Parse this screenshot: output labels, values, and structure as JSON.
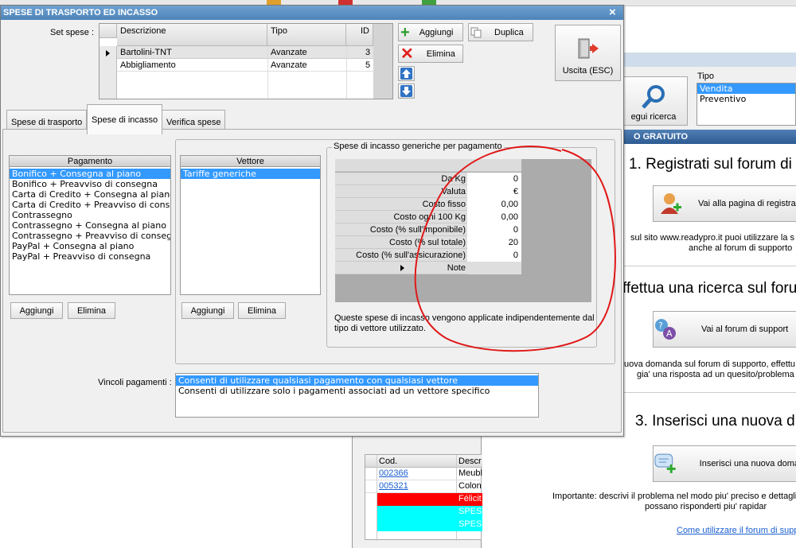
{
  "dialog": {
    "title": "SPESE DI TRASPORTO ED INCASSO",
    "close_glyph": "×"
  },
  "set_spese": {
    "label": "Set spese :",
    "columns": [
      "Descrizione",
      "Tipo",
      "ID"
    ],
    "rows": [
      {
        "desc": "Bartolini-TNT",
        "tipo": "Avanzate",
        "id": "3"
      },
      {
        "desc": "Abbigliamento",
        "tipo": "Avanzate",
        "id": "5"
      }
    ]
  },
  "toolbar": {
    "aggiungi": "Aggiungi",
    "duplica": "Duplica",
    "elimina": "Elimina",
    "uscita": "Uscita (ESC)"
  },
  "tabs": [
    "Spese di trasporto",
    "Spese di incasso",
    "Verifica spese"
  ],
  "pagamento": {
    "header": "Pagamento",
    "items": [
      "Bonifico + Consegna al piano",
      "Bonifico + Preavviso di consegna",
      "Carta di Credito + Consegna al piano",
      "Carta di Credito + Preavviso di consegna",
      "Contrassegno",
      "Contrassegno + Consegna al piano",
      "Contrassegno + Preavviso di consegna",
      "PayPal + Consegna al piano",
      "PayPal + Preavviso di consegna"
    ],
    "aggiungi": "Aggiungi",
    "elimina": "Elimina"
  },
  "vettore": {
    "header": "Vettore",
    "items": [
      "Tariffe generiche"
    ],
    "aggiungi": "Aggiungi",
    "elimina": "Elimina"
  },
  "generiche": {
    "title": "Spese di incasso generiche per pagamento",
    "rows": [
      {
        "label": "Da Kg",
        "value": "0"
      },
      {
        "label": "Valuta",
        "value": "€"
      },
      {
        "label": "Costo fisso",
        "value": "0,00"
      },
      {
        "label": "Costo ogni 100 Kg",
        "value": "0,00"
      },
      {
        "label": "Costo (% sull'imponibile)",
        "value": "0"
      },
      {
        "label": "Costo (% sul totale)",
        "value": "20"
      },
      {
        "label": "Costo (% sull'assicurazione)",
        "value": "0"
      },
      {
        "label": "Note",
        "value": ""
      }
    ],
    "description": "Queste spese di incasso vengono applicate indipendentemente dal tipo di vettore utilizzato."
  },
  "vincoli": {
    "label": "Vincoli pagamenti :",
    "items": [
      "Consenti di utilizzare qualsiasi pagamento con qualsiasi vettore",
      "Consenti di utilizzare solo i pagamenti associati ad un vettore specifico"
    ]
  },
  "background": {
    "search_label": "egui ricerca",
    "tipo_label": "Tipo",
    "tipo_items": [
      "Vendita",
      "Preventivo"
    ],
    "support_header": "O GRATUITO",
    "step1": "1. Registrati sul forum di",
    "btn1": "Vai alla pagina di registra",
    "text1a": "sul sito www.readypro.it puoi utilizzare la s",
    "text1b": "anche al forum di supporto",
    "step2": "ffettua una ricerca sul foru",
    "btn2": "Vai al forum di support",
    "text2a": "uova domanda sul forum di supporto, effettu",
    "text2b": "gia' una risposta ad un quesito/problema s",
    "step3": "3. Inserisci una nuova d",
    "btn3": "Inserisci una nuova doma",
    "text3a": "Importante: descrivi il problema nel modo piu' preciso e dettagli",
    "text3b": "possano risponderti piu' rapidar",
    "link": "Come utilizzare il forum di suppo",
    "table_cols": [
      "Cod.",
      "Descr"
    ],
    "table_rows": [
      {
        "cod": "002366",
        "desc": "Meubl"
      },
      {
        "cod": "005321",
        "desc": "Colon"
      },
      {
        "cod": "",
        "desc": "Félicit"
      },
      {
        "cod": "",
        "desc": "SPESE"
      },
      {
        "cod": "",
        "desc": "SPESE"
      }
    ]
  },
  "colors": {
    "title_bar": "#5c93c5",
    "selection": "#3399ff",
    "annotation": "#e01818",
    "red_row": "#ff0000",
    "cyan_row": "#00ffff"
  }
}
